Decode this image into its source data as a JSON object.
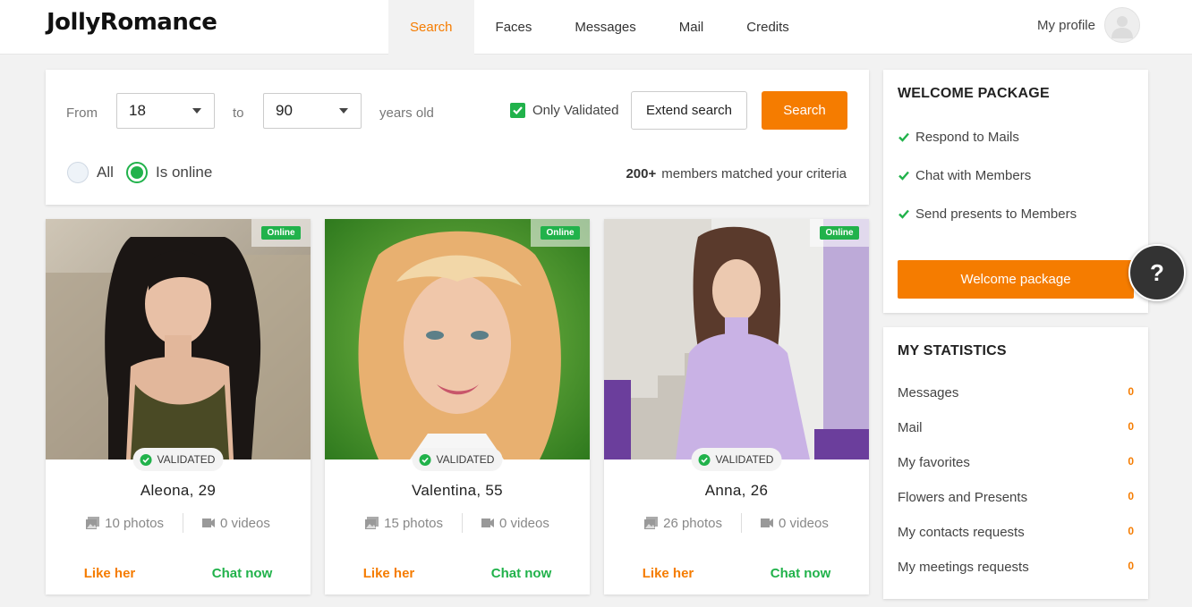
{
  "header": {
    "logo": "JollyRomance",
    "nav": [
      {
        "label": "Search",
        "active": true
      },
      {
        "label": "Faces",
        "active": false
      },
      {
        "label": "Messages",
        "active": false
      },
      {
        "label": "Mail",
        "active": false
      },
      {
        "label": "Credits",
        "active": false
      }
    ],
    "profile_label": "My profile"
  },
  "search": {
    "from_label": "From",
    "from_value": "18",
    "to_label": "to",
    "to_value": "90",
    "years_label": "years old",
    "only_validated_label": "Only Validated",
    "only_validated_checked": true,
    "extend_label": "Extend search",
    "search_label": "Search",
    "radio_all": "All",
    "radio_online": "Is online",
    "selected_radio": "Is online",
    "matched_count": "200+",
    "matched_text": "members matched your criteria"
  },
  "cards": [
    {
      "online": "Online",
      "validated": "VALIDATED",
      "name": "Aleona, 29",
      "photos": "10 photos",
      "videos": "0 videos",
      "like": "Like her",
      "chat": "Chat now"
    },
    {
      "online": "Online",
      "validated": "VALIDATED",
      "name": "Valentina, 55",
      "photos": "15 photos",
      "videos": "0 videos",
      "like": "Like her",
      "chat": "Chat now"
    },
    {
      "online": "Online",
      "validated": "VALIDATED",
      "name": "Anna, 26",
      "photos": "26 photos",
      "videos": "0 videos",
      "like": "Like her",
      "chat": "Chat now"
    }
  ],
  "welcome": {
    "title": "WELCOME PACKAGE",
    "items": [
      "Respond to Mails",
      "Chat with Members",
      "Send presents to Members"
    ],
    "button": "Welcome package"
  },
  "stats": {
    "title": "MY STATISTICS",
    "rows": [
      {
        "label": "Messages",
        "value": "0"
      },
      {
        "label": "Mail",
        "value": "0"
      },
      {
        "label": "My favorites",
        "value": "0"
      },
      {
        "label": "Flowers and Presents",
        "value": "0"
      },
      {
        "label": "My contacts requests",
        "value": "0"
      },
      {
        "label": "My meetings requests",
        "value": "0"
      }
    ]
  },
  "help_label": "?",
  "colors": {
    "accent": "#f57c00",
    "success": "#21b24b"
  }
}
